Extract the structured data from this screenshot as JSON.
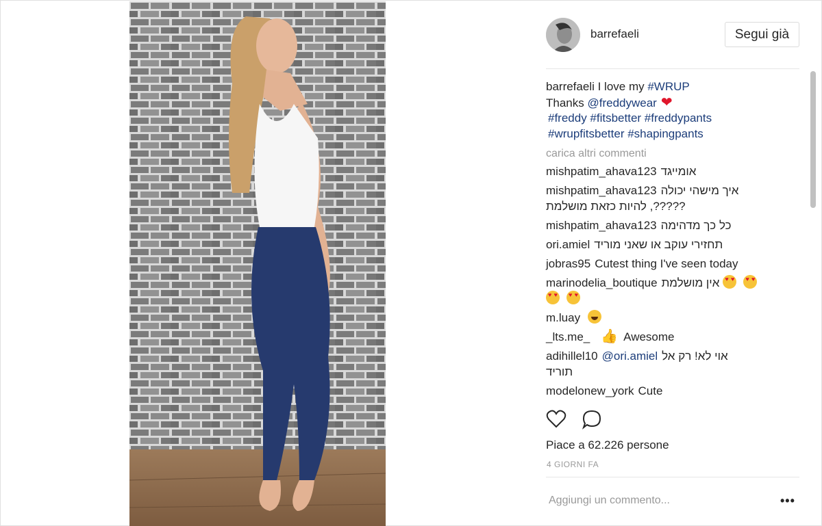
{
  "post": {
    "username": "barrefaeli",
    "follow_label": "Segui già",
    "caption": {
      "username": "barrefaeli",
      "line1_text": " I love my ",
      "line1_tag": "#WRUP",
      "line2_text": "Thanks ",
      "line2_mention": "@freddywear",
      "tags_line3": "#freddy #fitsbetter #freddypants",
      "tags_line4": "#wrupfitsbetter #shapingpants"
    },
    "load_more": "carica altri commenti",
    "comments": [
      {
        "user": "mishpatim_ahava123",
        "text": "אומייגד"
      },
      {
        "user": "mishpatim_ahava123",
        "text": "איך מישהי יכולה",
        "text2": "?????, להיות כזאת מושלמת"
      },
      {
        "user": "mishpatim_ahava123",
        "text": "כל כך מדהימה"
      },
      {
        "user": "ori.amiel",
        "text": "תחזירי עוקב או שאני מוריד"
      },
      {
        "user": "jobras95",
        "text": "Cutest thing I've seen today"
      },
      {
        "user": "marinodelia_boutique",
        "text": "אין מושלמת"
      },
      {
        "user": "m.luay",
        "text": ""
      },
      {
        "user": "_lts.me_",
        "text": "Awesome"
      },
      {
        "user": "adihillel10",
        "mention": "@ori.amiel",
        "text": "אוי לא! רק אל",
        "text2": "תוריד"
      },
      {
        "user": "modelonew_york",
        "text": "Cute"
      }
    ],
    "likes": "Piace a 62.226 persone",
    "timestamp": "4 GIORNI FA",
    "add_comment_placeholder": "Aggiungi un commento...",
    "more_options": "•••",
    "icons": {
      "like": "heart-outline-icon",
      "comment": "speech-bubble-icon"
    },
    "colors": {
      "hashtag": "#1c3d7a",
      "heart": "#e0162b",
      "muted": "#999999",
      "border": "#dbdbdb"
    }
  }
}
